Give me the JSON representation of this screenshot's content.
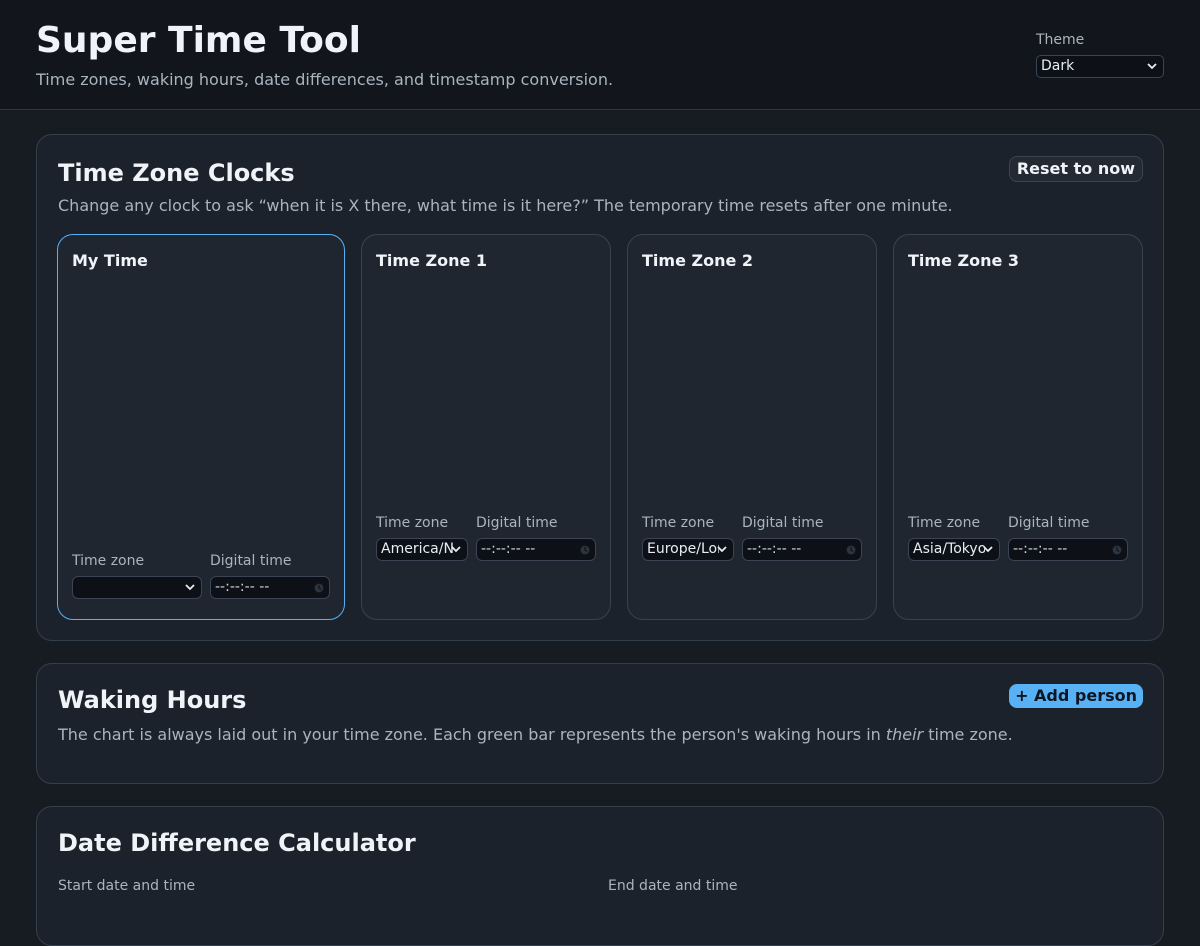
{
  "header": {
    "title": "Super Time Tool",
    "subtitle": "Time zones, waking hours, date differences, and timestamp conversion.",
    "theme_label": "Theme",
    "theme_value": "Dark"
  },
  "clocks_section": {
    "title": "Time Zone Clocks",
    "description": "Change any clock to ask “when it is X there, what time is it here?” The temporary time resets after one minute.",
    "reset_button": "Reset to now",
    "clocks": [
      {
        "title": "My Time",
        "tz_label": "Time zone",
        "tz_value": "",
        "time_label": "Digital time",
        "time_value": "--:--:-- --"
      },
      {
        "title": "Time Zone 1",
        "tz_label": "Time zone",
        "tz_value": "America/New_York",
        "time_label": "Digital time",
        "time_value": "--:--:-- --"
      },
      {
        "title": "Time Zone 2",
        "tz_label": "Time zone",
        "tz_value": "Europe/London",
        "time_label": "Digital time",
        "time_value": "--:--:-- --"
      },
      {
        "title": "Time Zone 3",
        "tz_label": "Time zone",
        "tz_value": "Asia/Tokyo",
        "time_label": "Digital time",
        "time_value": "--:--:-- --"
      }
    ]
  },
  "waking_section": {
    "title": "Waking Hours",
    "description_before": "The chart is always laid out in your time zone. Each green bar represents the person's waking hours in ",
    "description_emphasis": "their",
    "description_after": " time zone.",
    "add_button": "+ Add person"
  },
  "date_diff_section": {
    "title": "Date Difference Calculator",
    "start_label": "Start date and time",
    "end_label": "End date and time"
  },
  "colors": {
    "accent": "#58b1f5",
    "background": "#171b22",
    "card": "#1c222b"
  }
}
